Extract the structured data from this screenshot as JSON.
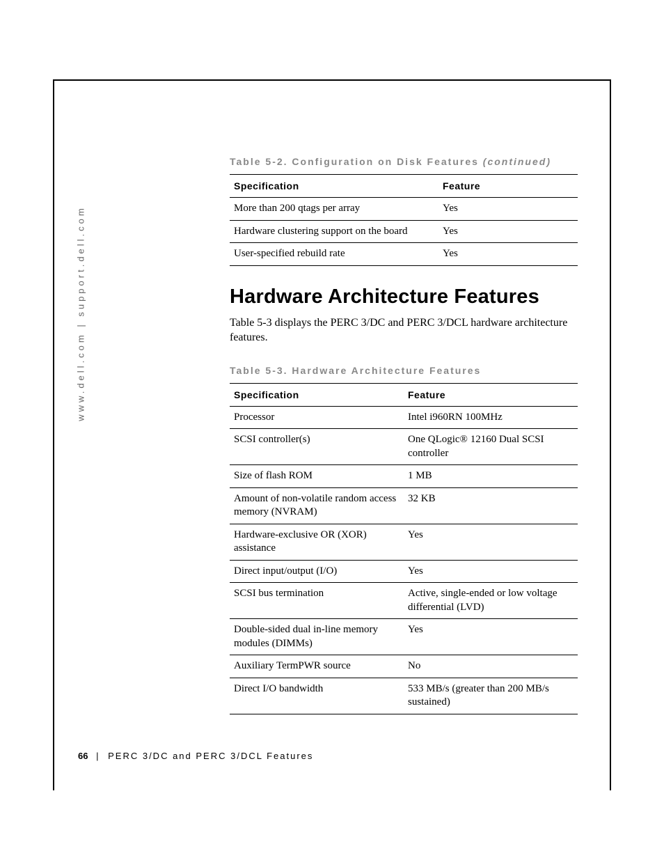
{
  "side_url": "www.dell.com | support.dell.com",
  "table52": {
    "caption_prefix": "Table 5-2. Configuration on Disk Features ",
    "caption_suffix": "(continued)",
    "headers": [
      "Specification",
      "Feature"
    ],
    "rows": [
      [
        "More than 200 qtags per array",
        "Yes"
      ],
      [
        "Hardware clustering support on the board",
        "Yes"
      ],
      [
        "User-specified rebuild rate",
        "Yes"
      ]
    ]
  },
  "section_heading": "Hardware Architecture Features",
  "section_body": "Table 5-3 displays the PERC 3/DC and PERC 3/DCL hardware architecture features.",
  "table53": {
    "caption": "Table 5-3. Hardware Architecture Features",
    "headers": [
      "Specification",
      "Feature"
    ],
    "rows": [
      [
        "Processor",
        "Intel i960RN 100MHz"
      ],
      [
        "SCSI controller(s)",
        "One QLogic® 12160 Dual SCSI controller"
      ],
      [
        "Size of flash ROM",
        "1 MB"
      ],
      [
        "Amount of non-volatile random access memory (NVRAM)",
        "32 KB"
      ],
      [
        "Hardware-exclusive OR (XOR) assistance",
        "Yes"
      ],
      [
        "Direct input/output (I/O)",
        "Yes"
      ],
      [
        "SCSI bus termination",
        "Active, single-ended or low voltage differential (LVD)"
      ],
      [
        "Double-sided dual in-line memory modules (DIMMs)",
        "Yes"
      ],
      [
        "Auxiliary TermPWR source",
        "No"
      ],
      [
        "Direct I/O bandwidth",
        "533 MB/s (greater than 200 MB/s sustained)"
      ]
    ]
  },
  "footer": {
    "page_number": "66",
    "separator": "|",
    "title": "PERC 3/DC and PERC 3/DCL Features"
  }
}
